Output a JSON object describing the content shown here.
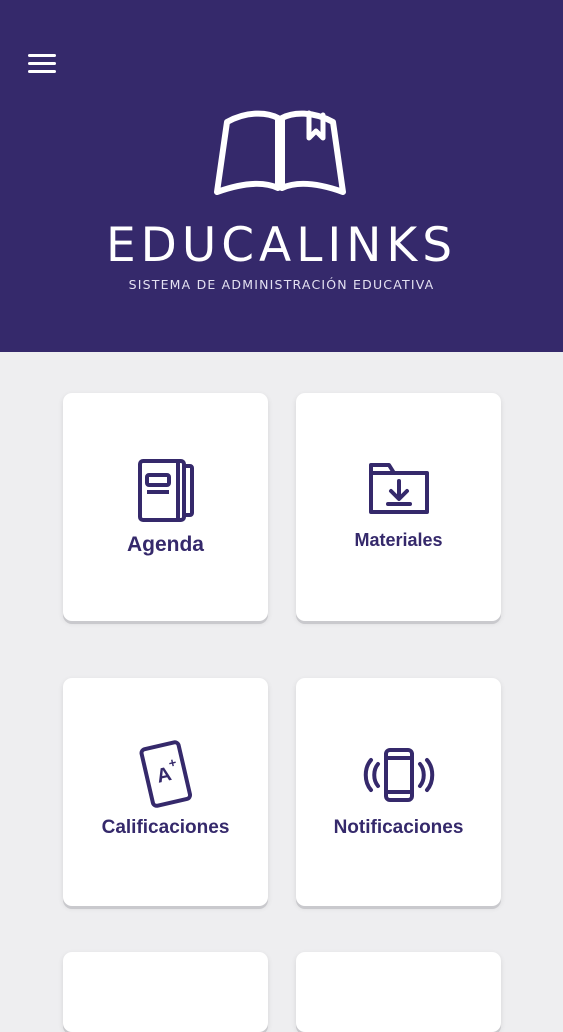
{
  "header": {
    "menu_icon": "hamburger-menu-icon",
    "logo_icon": "open-book-bookmark-icon",
    "brand_name": "EDUCALINKS",
    "tagline": "SISTEMA DE ADMINISTRACIÓN EDUCATIVA",
    "background_color": "#35296b"
  },
  "tiles": [
    {
      "label": "Agenda",
      "icon": "agenda-notebook-icon"
    },
    {
      "label": "Materiales",
      "icon": "folder-download-icon"
    },
    {
      "label": "Calificaciones",
      "icon": "grade-card-a-plus-icon"
    },
    {
      "label": "Notificaciones",
      "icon": "phone-vibrate-icon"
    }
  ],
  "colors": {
    "primary": "#35296b",
    "page_background": "#eeeef0",
    "tile_background": "#ffffff"
  }
}
